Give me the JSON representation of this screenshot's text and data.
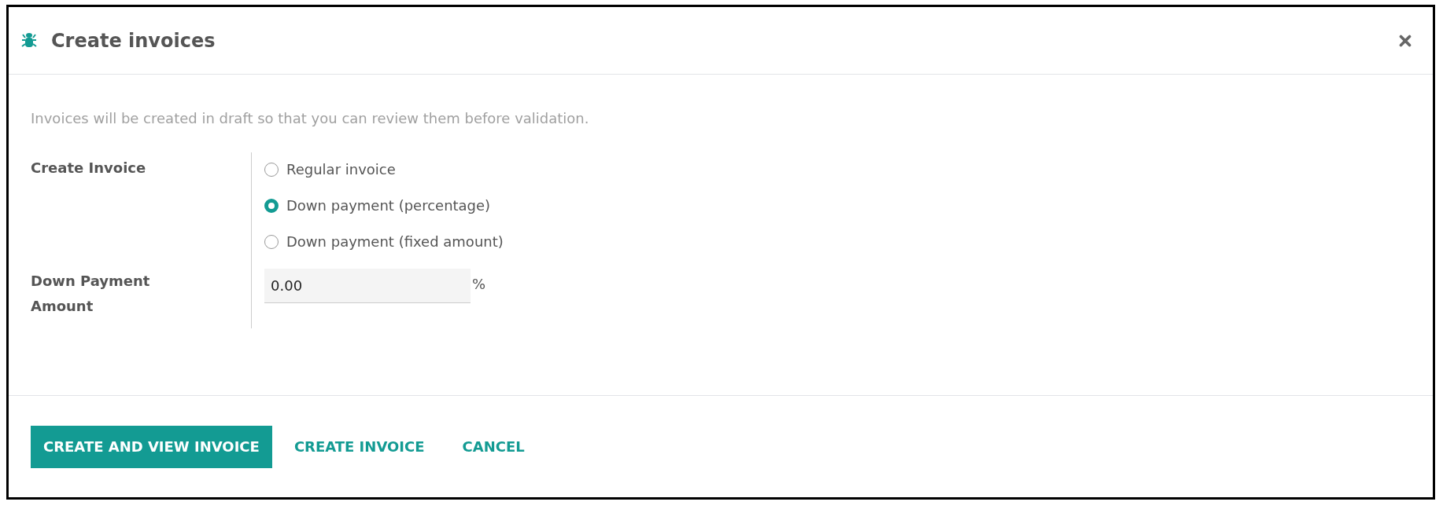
{
  "dialog": {
    "title": "Create invoices",
    "description": "Invoices will be created in draft so that you can review them before validation.",
    "fields": [
      {
        "kind": "radio",
        "label": "Create Invoice",
        "options": [
          {
            "label": "Regular invoice",
            "selected": false
          },
          {
            "label": "Down payment (percentage)",
            "selected": true
          },
          {
            "label": "Down payment (fixed amount)",
            "selected": false
          }
        ]
      },
      {
        "kind": "input",
        "label": "Down Payment Amount",
        "value": "0.00",
        "unit": "%"
      }
    ],
    "buttons": [
      {
        "label": "CREATE AND VIEW INVOICE",
        "primary": true
      },
      {
        "label": "CREATE INVOICE",
        "primary": false
      },
      {
        "label": "CANCEL",
        "primary": false
      }
    ]
  }
}
